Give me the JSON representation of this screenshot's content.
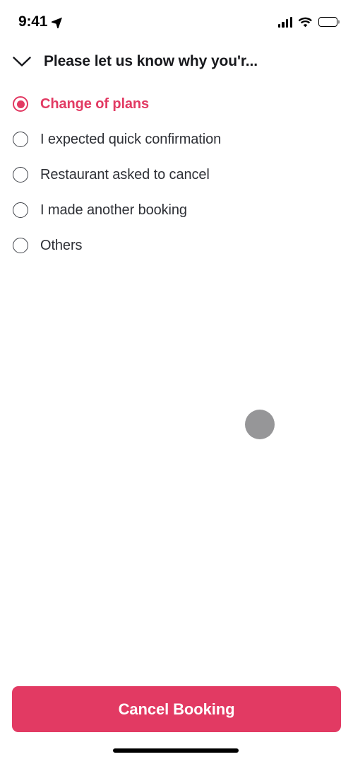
{
  "status_bar": {
    "time": "9:41",
    "location_icon": "location-arrow-icon",
    "signal_icon": "cellular-signal-icon",
    "wifi_icon": "wifi-icon",
    "battery_icon": "battery-full-icon"
  },
  "header": {
    "back_icon": "chevron-down-icon",
    "title": "Please let us know why you'r..."
  },
  "options": {
    "items": [
      {
        "label": "Change of plans",
        "selected": true
      },
      {
        "label": "I expected quick confirmation",
        "selected": false
      },
      {
        "label": "Restaurant asked to cancel",
        "selected": false
      },
      {
        "label": "I made another booking",
        "selected": false
      },
      {
        "label": "Others",
        "selected": false
      }
    ]
  },
  "decoration": {
    "dot_name": "gray-circle-placeholder"
  },
  "footer": {
    "cancel_label": "Cancel Booking"
  },
  "colors": {
    "accent": "#e23a63",
    "text_primary": "#2e3036",
    "title": "#17181c",
    "gray_dot": "#969698",
    "background": "#ffffff"
  }
}
